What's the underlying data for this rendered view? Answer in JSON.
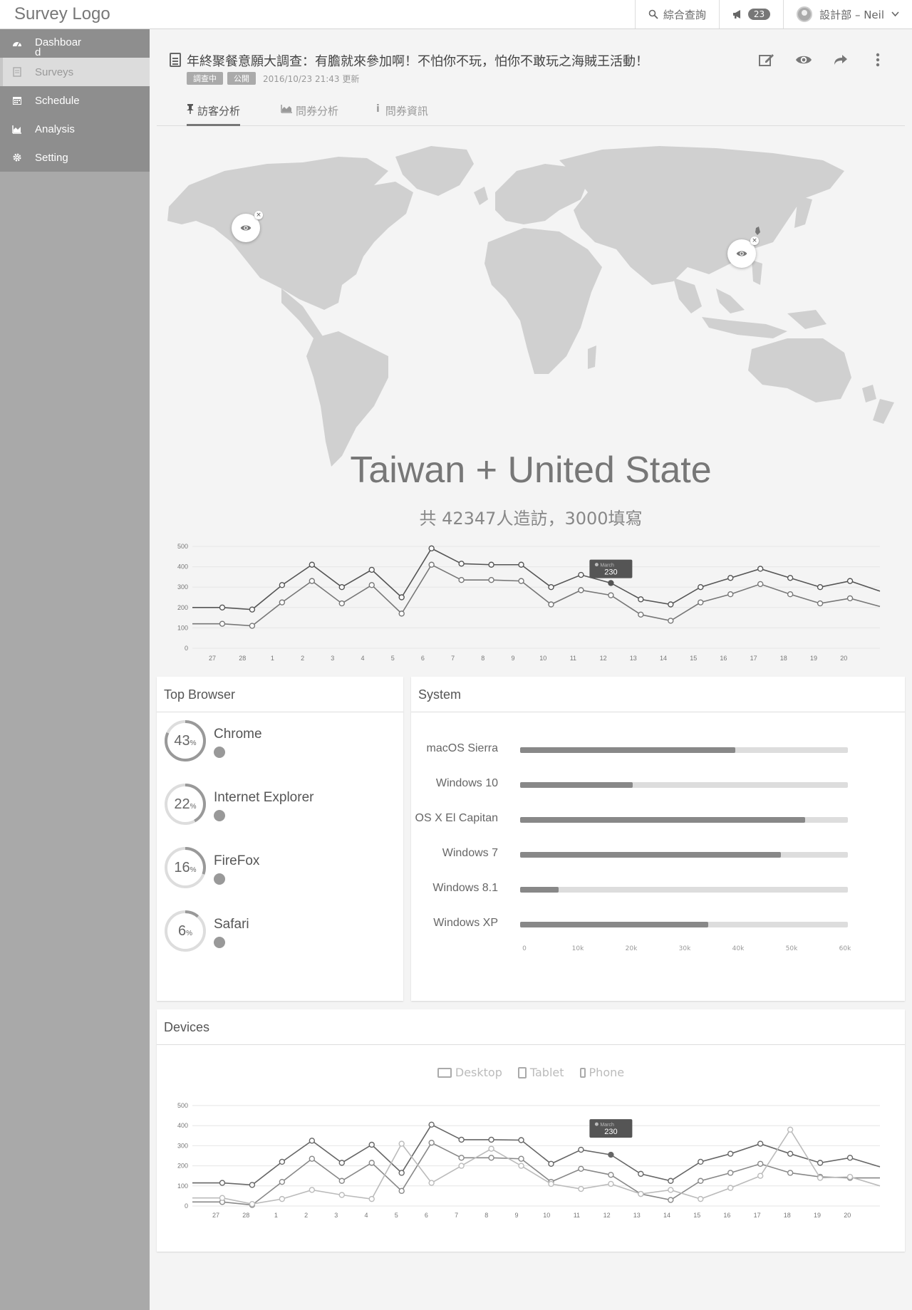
{
  "app": {
    "logo": "Survey Logo",
    "search_label": "綜合查詢",
    "notification_count": "23",
    "user": "設計部 – Neil"
  },
  "sidebar": {
    "items": [
      {
        "label": "Dashboard",
        "icon": "dashboard-icon"
      },
      {
        "label": "Surveys",
        "icon": "document-icon",
        "active": true
      },
      {
        "label": "Schedule",
        "icon": "calendar-icon"
      },
      {
        "label": "Analysis",
        "icon": "area-chart-icon"
      },
      {
        "label": "Setting",
        "icon": "gear-icon"
      }
    ]
  },
  "survey": {
    "title": "年終聚餐意願大調查：有膽就來參加啊！不怕你不玩，怕你不敢玩之海賊王活動！",
    "status_tag": "調查中",
    "visibility_tag": "公開",
    "updated": "2016/10/23 21:43 更新"
  },
  "tabs": [
    {
      "label": "訪客分析",
      "icon": "pin-icon",
      "active": true
    },
    {
      "label": "問券分析",
      "icon": "area-chart-icon"
    },
    {
      "label": "問券資訊",
      "icon": "info-icon"
    }
  ],
  "visitors": {
    "region": "Taiwan + United State",
    "summary": "共 42347人造訪，3000填寫"
  },
  "browser_card": {
    "title": "Top Browser",
    "items": [
      {
        "name": "Chrome",
        "percent": 43,
        "pct_label": "43"
      },
      {
        "name": "Internet Explorer",
        "percent": 22,
        "pct_label": "22"
      },
      {
        "name": "FireFox",
        "percent": 16,
        "pct_label": "16"
      },
      {
        "name": "Safari",
        "percent": 6,
        "pct_label": "6"
      }
    ],
    "pct_unit": "%"
  },
  "system_card": {
    "title": "System",
    "items": [
      {
        "name": "macOS Sierra",
        "value": 40000
      },
      {
        "name": "Windows 10",
        "value": 21000
      },
      {
        "name": "OS X El Capitan",
        "value": 53000
      },
      {
        "name": "Windows 7",
        "value": 48500
      },
      {
        "name": "Windows 8.1",
        "value": 7200
      },
      {
        "name": "Windows  XP",
        "value": 35000
      }
    ],
    "ticks": [
      "0",
      "10k",
      "20k",
      "30k",
      "40k",
      "50k",
      "60k"
    ],
    "max": 61000
  },
  "devices_card": {
    "title": "Devices",
    "legend": [
      {
        "label": "Desktop",
        "icon": "desktop-icon"
      },
      {
        "label": "Tablet",
        "icon": "tablet-icon"
      },
      {
        "label": "Phone",
        "icon": "phone-icon"
      }
    ]
  },
  "tooltip": {
    "label": "March",
    "value": "230"
  },
  "chart_data": [
    {
      "type": "line",
      "x": [
        "27",
        "28",
        "1",
        "2",
        "3",
        "4",
        "5",
        "6",
        "7",
        "8",
        "9",
        "10",
        "11",
        "12",
        "13",
        "14",
        "15",
        "16",
        "17",
        "18",
        "19",
        "20"
      ],
      "ylim": [
        0,
        500
      ],
      "yticks": [
        0,
        100,
        200,
        300,
        400,
        500
      ],
      "series": [
        {
          "values": [
            200,
            200,
            190,
            310,
            410,
            300,
            385,
            250,
            490,
            415,
            410,
            410,
            300,
            360,
            320,
            240,
            215,
            300,
            345,
            390,
            345,
            300,
            330,
            280
          ],
          "color": "#555555"
        },
        {
          "values": [
            120,
            120,
            110,
            225,
            330,
            220,
            310,
            170,
            410,
            335,
            335,
            330,
            215,
            285,
            260,
            165,
            135,
            225,
            265,
            315,
            265,
            220,
            245,
            205
          ],
          "color": "#777777"
        }
      ]
    },
    {
      "type": "line",
      "x": [
        "27",
        "28",
        "1",
        "2",
        "3",
        "4",
        "5",
        "6",
        "7",
        "8",
        "9",
        "10",
        "11",
        "12",
        "13",
        "14",
        "15",
        "16",
        "17",
        "18",
        "19",
        "20"
      ],
      "ylim": [
        0,
        500
      ],
      "yticks": [
        0,
        100,
        200,
        300,
        400,
        500
      ],
      "series": [
        {
          "name": "Desktop",
          "values": [
            115,
            115,
            105,
            220,
            325,
            215,
            305,
            165,
            405,
            330,
            330,
            328,
            210,
            280,
            255,
            160,
            125,
            220,
            260,
            310,
            260,
            215,
            240,
            195
          ],
          "color": "#666666"
        },
        {
          "name": "Tablet",
          "values": [
            20,
            20,
            5,
            120,
            235,
            125,
            215,
            75,
            315,
            240,
            240,
            235,
            120,
            185,
            155,
            60,
            30,
            125,
            165,
            210,
            165,
            145,
            140,
            140
          ],
          "color": "#888888"
        },
        {
          "name": "Phone",
          "values": [
            40,
            40,
            10,
            35,
            80,
            55,
            35,
            310,
            115,
            200,
            285,
            200,
            110,
            85,
            110,
            60,
            80,
            35,
            90,
            150,
            380,
            140,
            145,
            100
          ],
          "color": "#bbbbbb"
        }
      ]
    }
  ]
}
